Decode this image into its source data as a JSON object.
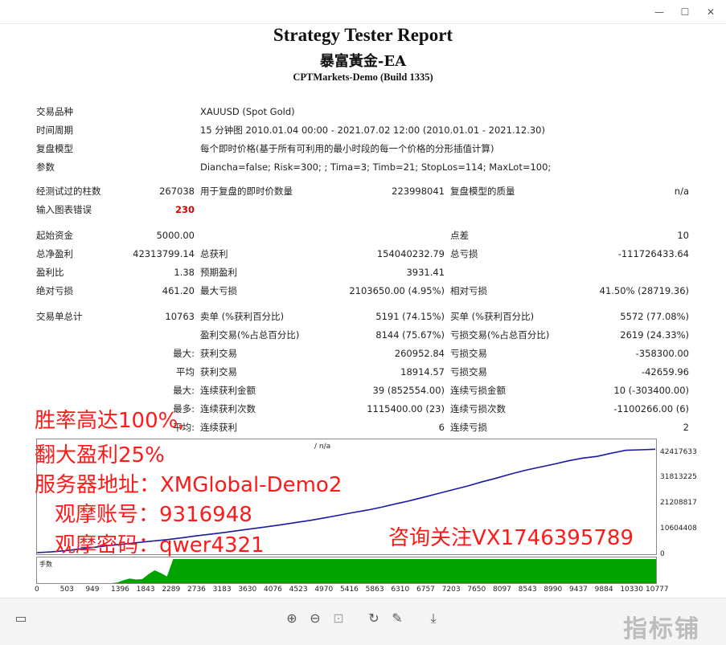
{
  "window": {
    "minimize": "—",
    "maximize": "☐",
    "close": "✕"
  },
  "header": {
    "title": "Strategy Tester Report",
    "subtitle": "暴富黃金-EA",
    "build": "CPTMarkets-Demo (Build 1335)"
  },
  "info": [
    {
      "label": "交易品种",
      "value": "XAUUSD (Spot Gold)"
    },
    {
      "label": "时间周期",
      "value": "15 分钟图 2010.01.04 00:00 - 2021.07.02 12:00 (2010.01.01 - 2021.12.30)"
    },
    {
      "label": "复盘模型",
      "value": "每个即时价格(基于所有可利用的最小时段的每一个价格的分形插值计算)"
    },
    {
      "label": "参数",
      "value": "Diancha=false; Risk=300; ; Tima=3; Timb=21; StopLos=114; MaxLot=100;"
    }
  ],
  "bars": {
    "label": "经测试过的柱数",
    "value": "267038",
    "ticks_label": "用于复盘的即时价数量",
    "ticks_value": "223998041",
    "quality_label": "复盘模型的质量",
    "quality_value": "n/a",
    "errors_label": "输入图表错误",
    "errors_value": "230"
  },
  "stats": {
    "deposit_label": "起始资金",
    "deposit": "5000.00",
    "spread_label": "点差",
    "spread": "10",
    "net_label": "总净盈利",
    "net": "42313799.14",
    "gross_profit_label": "总获利",
    "gross_profit": "154040232.79",
    "gross_loss_label": "总亏损",
    "gross_loss": "-111726433.64",
    "pf_label": "盈利比",
    "pf": "1.38",
    "exp_label": "预期盈利",
    "exp": "3931.41",
    "abs_dd_label": "绝对亏损",
    "abs_dd": "461.20",
    "max_dd_label": "最大亏损",
    "max_dd": "2103650.00 (4.95%)",
    "rel_dd_label": "相对亏损",
    "rel_dd": "41.50% (28719.36)"
  },
  "trades": {
    "total_label": "交易单总计",
    "total": "10763",
    "short_label": "卖单 (%获利百分比)",
    "short": "5191 (74.15%)",
    "long_label": "买单 (%获利百分比)",
    "long": "5572 (77.08%)",
    "win_label": "盈利交易(%占总百分比)",
    "win": "8144 (75.67%)",
    "loss_label": "亏损交易(%占总百分比)",
    "loss": "2619 (24.33%)",
    "max_q": "最大:",
    "max_win_label": "获利交易",
    "max_win": "260952.84",
    "max_loss_label": "亏损交易",
    "max_loss": "-358300.00",
    "avg_q": "平均",
    "avg_win_label": "获利交易",
    "avg_win": "18914.57",
    "avg_loss_label": "亏损交易",
    "avg_loss": "-42659.96",
    "max2_q": "最大:",
    "cons_win_amt_label": "连续获利金额",
    "cons_win_amt": "39 (852554.00)",
    "cons_loss_amt_label": "连续亏损金额",
    "cons_loss_amt": "10 (-303400.00)",
    "most_q": "最多:",
    "cons_win_cnt_label": "连续获利次数",
    "cons_win_cnt": "1115400.00 (23)",
    "cons_loss_cnt_label": "连续亏损次数",
    "cons_loss_cnt": "-1100266.00 (6)",
    "avg2_q": "平均:",
    "avg_cons_win_label": "连续获利",
    "avg_cons_win": "6",
    "avg_cons_loss_label": "连续亏损",
    "avg_cons_loss": "2"
  },
  "chart_data": {
    "type": "line",
    "caption": "/ n/a",
    "ylabels": [
      "42417633",
      "31813225",
      "21208817",
      "10604408",
      "0"
    ],
    "xlabels": [
      "0",
      "503",
      "949",
      "1396",
      "1843",
      "2289",
      "2736",
      "3183",
      "3630",
      "4076",
      "4523",
      "4970",
      "5416",
      "5863",
      "6310",
      "6757",
      "7203",
      "7650",
      "8097",
      "8543",
      "8990",
      "9437",
      "9884",
      "10330",
      "10777"
    ],
    "volume_label": "手数",
    "series": [
      {
        "color": "#1a1aa6",
        "x": [
          0,
          250,
          500,
          750,
          1000,
          1250,
          1500,
          1750,
          2000,
          2250,
          2500,
          2750,
          3000,
          3250,
          3500,
          3750,
          4000,
          4250,
          4500,
          4750,
          5000,
          5250,
          5500,
          5750,
          6000,
          6250,
          6500,
          6750,
          7000,
          7250,
          7500,
          7750,
          8000,
          8250,
          8500,
          8750,
          9000,
          9250,
          9500,
          9750,
          10000,
          10250,
          10500,
          10763
        ],
        "y": [
          5000,
          300000,
          800000,
          1500000,
          2200000,
          2900000,
          3500000,
          4100000,
          4700000,
          5300000,
          6000000,
          6800000,
          7500000,
          8200000,
          9000000,
          9800000,
          10600000,
          11400000,
          12300000,
          13200000,
          14200000,
          15300000,
          16400000,
          17400000,
          18600000,
          20000000,
          21300000,
          22800000,
          24300000,
          25800000,
          27300000,
          29000000,
          30500000,
          32200000,
          33700000,
          35000000,
          36200000,
          37600000,
          38700000,
          39400000,
          40700000,
          41900000,
          42100000,
          42313799
        ]
      }
    ],
    "volume_color": "#00a300"
  },
  "overlay": {
    "line1": "胜率高达100%,",
    "line2": "翻大盈利25%",
    "line3": "服务器地址：XMGlobal-Demo2",
    "line4": "观摩账号：9316948",
    "line5": "观摩密码：qwer4321",
    "contact": "咨询关注VX1746395789"
  },
  "toolbar": {
    "sidebar": "▭",
    "zoom_in": "⊕",
    "zoom_out": "⊖",
    "fit": "⊡",
    "rotate": "↻",
    "edit": "✎",
    "download": "⤓"
  },
  "watermark": "指标铺"
}
